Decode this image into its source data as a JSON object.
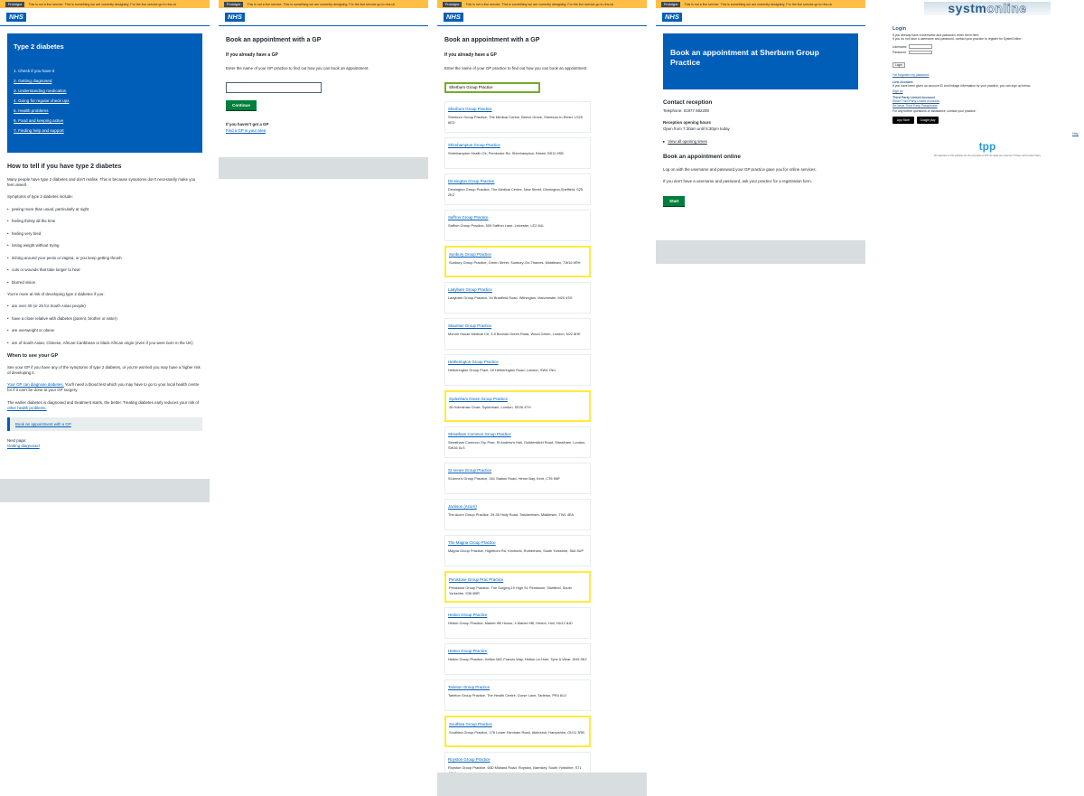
{
  "phase_banner": {
    "tag": "Prototype",
    "text": "This is not a live service. This is something we are currently designing. For the live service go to nhs.uk"
  },
  "nhs_logo": "NHS",
  "panel1": {
    "hero_title": "Type 2 diabetes",
    "contents": [
      "1. Check if you have it",
      "2. Getting diagnosed",
      "3. Understanding medication",
      "4. Going for regular check ups",
      "5. Health problems",
      "6. Food and keeping active",
      "7. Finding help and support"
    ],
    "heading": "How to tell if you have type 2 diabetes",
    "intro": "Many people have type 2 diabetes and don't realise. This is because symptoms don't necessarily make you feel unwell.",
    "symptoms_intro": "Symptoms of type 2 diabetes include:",
    "symptoms": [
      "peeing more than usual, particularly at night",
      "feeling thirsty all the time",
      "feeling very tired",
      "losing weight without trying",
      "itching around your penis or vagina, or you keep getting thrush",
      "cuts or wounds that take longer to heal",
      "blurred vision"
    ],
    "risk_intro": "You're more at risk of developing type 2 diabetes if you:",
    "risks": [
      "are over 40 (or 25 for South Asian people)",
      "have a close relative with diabetes (parent, brother or sister)",
      "are overweight or obese",
      "are of South Asian, Chinese, African-Caribbean or black African origin (even if you were born in the UK)"
    ],
    "when_heading": "When to see your GP",
    "when_text": "See your GP if you have any of the symptoms of type 2 diabetes, or you're worried you may have a higher risk of developing it.",
    "diagnose_link": "Your GP can diagnose diabetes.",
    "diagnose_text": " You'll need a blood test which you may have to go to your local health centre for if it can't be done at your GP surgery.",
    "earlier_text": "The earlier diabetes is diagnosed and treatment starts, the better. Treating diabetes early reduces your risk of ",
    "earlier_link": "other health problems.",
    "cta": "Book an appointment with a GP",
    "next_label": "Next page:",
    "next_link": "Getting diagnosed"
  },
  "panel2": {
    "title": "Book an appointment with a GP",
    "subtitle": "If you already have a GP",
    "hint": "Enter the name of your GP practice to find out how you can book an appointment.",
    "input_value": "",
    "button": "Continue",
    "no_gp_heading": "If you haven't got a GP",
    "no_gp_link": "Find a GP in your area"
  },
  "panel3": {
    "title": "Book an appointment with a GP",
    "subtitle": "If you already have a GP",
    "hint": "Enter the name of your GP practice to find out how you can book an appointment.",
    "input_value": "Sherburn Group Practice",
    "results": [
      {
        "name": "Sherburn Group Practice",
        "address": "Sherburn Group Practice, The Medical Centre, Beech Grove, Sherburn-in-Elmet, LS25 6ED",
        "highlight": false
      },
      {
        "name": "Shirehampton Group Practice",
        "address": "Shirehampton Health Ctr, Pembroke Rd, Shirehampton, Bristol, BS11 9SB",
        "highlight": false
      },
      {
        "name": "Dinnington Group Practice",
        "address": "Dinnington Group Practice, The Medical Centre, New Street, Dinnington,Sheffield, S25 2EZ",
        "highlight": false
      },
      {
        "name": "Saffron Group Practice",
        "address": "Saffron Group Practice, 509 Saffron Lane, Leicester, LE2 6UL",
        "highlight": false
      },
      {
        "name": "Sunbury Group Practice",
        "address": "Sunbury Group Practice, Green Street, Sunbury-On-Thames, Middlesex, TW16 6RH",
        "highlight": true
      },
      {
        "name": "Ladybarn Group Practice",
        "address": "Ladybarn Group Practice, 54 Briarfield Road, Withington, Manchester, M20 4SS",
        "highlight": false
      },
      {
        "name": "Staunton Group Practice",
        "address": "Morum House Medical Ctr, 3-5 Bounds Green Road, Wood Green, London, N22 8HE",
        "highlight": false
      },
      {
        "name": "Hetherington Group Practice",
        "address": "Hetherington Group Pract, 18 Hetherington Road, London, SW4 7NU",
        "highlight": false
      },
      {
        "name": "Sydenham Green Group Practice",
        "address": "26 Holmshaw Close, Sydenham, London, SE26 4TH",
        "highlight": true
      },
      {
        "name": "Streatham Common Group Practice",
        "address": "Streatham Common Grp Prac, St Andrew's Hall, Guildersfield Road, Streatham, London, SW16 5LS",
        "highlight": false
      },
      {
        "name": "St Annes Group Practice",
        "address": "St Anne's Group Practice, 161 Station Road, Herne Bay, Kent, CT6 5NF",
        "highlight": false
      },
      {
        "name": "Jackson (Acorn)",
        "address": "The Acorn Group Practice, 29-35 Holly Road, Twickenham, Middlesex, TW1 4EA",
        "highlight": false
      },
      {
        "name": "The Magna Group Practice",
        "address": "Magna Group Practice, Highthorn Rd, Kimhurst, Rotherham, South Yorkshire, S64 5UP",
        "highlight": false
      },
      {
        "name": "Penistone Group Prac Practice",
        "address": "Penistone Group Practice, The Surgery,19 High St, Penistone, Sheffield, South Yorkshire, S36 6BR",
        "highlight": true
      },
      {
        "name": "Hedon Group Practice",
        "address": "Hedon Group Practice, Market Hill House, 4 Market Hill, Hedon, Hull, HU12 8JD",
        "highlight": false
      },
      {
        "name": "Hetton Group Practice",
        "address": "Hetton Group Practice, Hetton M/C,Francis Way, Hetton-Le-Hole, Tyne & Wear, DH5 9EZ",
        "highlight": false
      },
      {
        "name": "Tarleton Group Practice",
        "address": "Tarleton Group Practice, The Health Centre, Gorse Lane, Tarleton, PR4 6UJ",
        "highlight": false
      },
      {
        "name": "Southlea Group Practice",
        "address": "Southlea Group Practice, 276 Lower Farnham Road, Aldershot, Hampshire, GU11 3RB",
        "highlight": true
      },
      {
        "name": "Royston Group Practice",
        "address": "Royston Group Practice, 65D Midland Road, Royston, Barnsley, South Yorkshire, S71 4QW",
        "highlight": false
      },
      {
        "name": "Newbury Group Practice",
        "address": "Newbury Group Practice, Newbury Park Health Ctre, 40 Perrymans Farm Road, Newbury Park, IG2 7LE",
        "highlight": false
      }
    ]
  },
  "panel4": {
    "banner": "Book an appointment at Sherburn Group Practice",
    "contact_heading": "Contact reception",
    "telephone": "Telephone: 01977 682208",
    "hours_heading": "Reception opening hours",
    "hours": "Open from 7:30am until 5:30pm today",
    "all_times": "View all opening times",
    "online_heading": "Book an appointment online",
    "online_text": "Log on with the username and password your GP practice gave you for online services.",
    "no_account_text": "If you don't have a username and password, ask your practice for a registration form.",
    "button": "Start"
  },
  "panel5": {
    "logo_a": "systm",
    "logo_b": "online",
    "login_title": "Login",
    "login_intro_1": "If you already have a username and password, enter them here.",
    "login_intro_2": "If you do not have a username and password, contact your practice to register for SystmOnline.",
    "username_label": "Username",
    "password_label": "Password",
    "login_button": "Login",
    "forgot_link": "I've forgotten my password",
    "link_account_heading": "Link Account",
    "link_account_text": "If you have been given an account ID and linkage information by your practice, you can sign up below.",
    "signup_link": "Sign up",
    "third_party_heading": "Third Party Linked Account",
    "reset_link": "Reset Third Party Linked Accounts",
    "renew_link": "Re-issue Third Party Passphrase",
    "questions_text": "For any further questions or assistance, contact your practice.",
    "app_store": "App Store",
    "google_play": "Google play",
    "help_link": "Help",
    "tpp_logo": "tpp",
    "tpp_footer": "All materials on this website are the copyright of TPP. All rights are reserved. Privacy and Cookie Policy"
  }
}
